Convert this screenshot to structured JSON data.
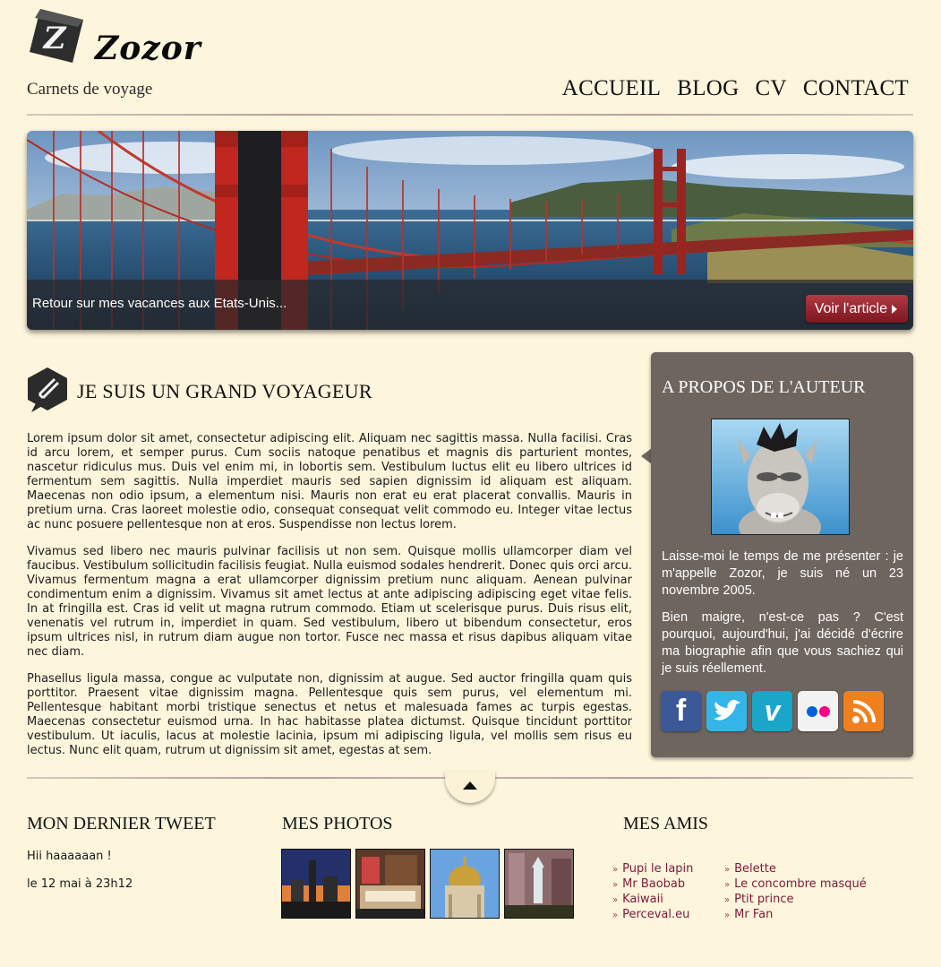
{
  "site": {
    "name": "Zozor",
    "tagline": "Carnets de voyage"
  },
  "nav": [
    "ACCUEIL",
    "BLOG",
    "CV",
    "CONTACT"
  ],
  "banner": {
    "caption": "Retour sur mes vacances aux Etats-Unis...",
    "button_label": "Voir l'article"
  },
  "article": {
    "title": "JE SUIS UN GRAND VOYAGEUR",
    "paragraphs": [
      "Lorem ipsum dolor sit amet, consectetur adipiscing elit. Aliquam nec sagittis massa. Nulla facilisi. Cras id arcu lorem, et semper purus. Cum sociis natoque penatibus et magnis dis parturient montes, nascetur ridiculus mus. Duis vel enim mi, in lobortis sem. Vestibulum luctus elit eu libero ultrices id fermentum sem sagittis. Nulla imperdiet mauris sed sapien dignissim id aliquam est aliquam. Maecenas non odio ipsum, a elementum nisi. Mauris non erat eu erat placerat convallis. Mauris in pretium urna. Cras laoreet molestie odio, consequat consequat velit commodo eu. Integer vitae lectus ac nunc posuere pellentesque non at eros. Suspendisse non lectus lorem.",
      "Vivamus sed libero nec mauris pulvinar facilisis ut non sem. Quisque mollis ullamcorper diam vel faucibus. Vestibulum sollicitudin facilisis feugiat. Nulla euismod sodales hendrerit. Donec quis orci arcu. Vivamus fermentum magna a erat ullamcorper dignissim pretium nunc aliquam. Aenean pulvinar condimentum enim a dignissim. Vivamus sit amet lectus at ante adipiscing adipiscing eget vitae felis. In at fringilla est. Cras id velit ut magna rutrum commodo. Etiam ut scelerisque purus. Duis risus elit, venenatis vel rutrum in, imperdiet in quam. Sed vestibulum, libero ut bibendum consectetur, eros ipsum ultrices nisl, in rutrum diam augue non tortor. Fusce nec massa et risus dapibus aliquam vitae nec diam.",
      "Phasellus ligula massa, congue ac vulputate non, dignissim at augue. Sed auctor fringilla quam quis porttitor. Praesent vitae dignissim magna. Pellentesque quis sem purus, vel elementum mi. Pellentesque habitant morbi tristique senectus et netus et malesuada fames ac turpis egestas. Maecenas consectetur euismod urna. In hac habitasse platea dictumst. Quisque tincidunt porttitor vestibulum. Ut iaculis, lacus at molestie lacinia, ipsum mi adipiscing ligula, vel mollis sem risus eu lectus. Nunc elit quam, rutrum ut dignissim sit amet, egestas at sem."
    ]
  },
  "about": {
    "title": "A PROPOS DE L'AUTEUR",
    "paragraphs": [
      "Laisse-moi le temps de me présenter : je m'appelle Zozor, je suis né un 23 novembre 2005.",
      "Bien maigre, n'est-ce pas ? C'est pourquoi, aujourd'hui, j'ai décidé d'écrire ma biographie afin que vous sachiez qui je suis réellement."
    ],
    "social": [
      {
        "icon": "facebook-icon",
        "color": "#3b5998"
      },
      {
        "icon": "twitter-icon",
        "color": "#33b5e8"
      },
      {
        "icon": "vimeo-icon",
        "color": "#1aa6c9"
      },
      {
        "icon": "flickr-icon",
        "color": "#f2f2f2"
      },
      {
        "icon": "rss-icon",
        "color": "#f0801e"
      }
    ]
  },
  "tweet": {
    "title": "MON DERNIER TWEET",
    "text": "Hii haaaaaan !",
    "date": "le 12 mai à 23h12"
  },
  "photos": {
    "title": "MES PHOTOS"
  },
  "friends": {
    "title": "MES AMIS",
    "col1": [
      "Pupi le lapin",
      "Mr Baobab",
      "Kaiwaii",
      "Perceval.eu"
    ],
    "col2": [
      "Belette",
      "Le concombre masqué",
      "Ptit prince",
      "Mr Fan"
    ]
  }
}
